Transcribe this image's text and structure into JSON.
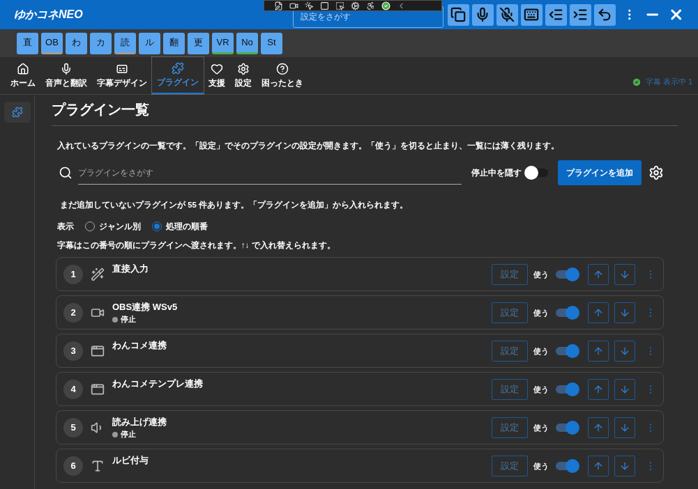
{
  "window": {
    "title": "ゆかコネNEO"
  },
  "title_search": {
    "placeholder": "設定をさがす"
  },
  "quick_buttons": [
    {
      "label": "直"
    },
    {
      "label": "OB",
      "color": "#9e9e9e"
    },
    {
      "label": "わ"
    },
    {
      "label": "カ"
    },
    {
      "label": "読",
      "color": "#9e9e9e"
    },
    {
      "label": "ル"
    },
    {
      "label": "翻"
    },
    {
      "label": "更"
    },
    {
      "label": "VR",
      "color": "#4caf50"
    },
    {
      "label": "No",
      "color": "#4caf50"
    },
    {
      "label": "St"
    }
  ],
  "tabs": [
    {
      "label": "ホーム",
      "selected": false
    },
    {
      "label": "音声と翻訳",
      "selected": false
    },
    {
      "label": "字幕デザイン",
      "selected": false
    },
    {
      "label": "プラグイン",
      "selected": true
    },
    {
      "label": "支援",
      "selected": false
    },
    {
      "label": "設定",
      "selected": false
    },
    {
      "label": "困ったとき",
      "selected": false
    }
  ],
  "status": {
    "text": "字幕 表示中 1"
  },
  "page": {
    "title": "プラグイン一覧",
    "description": "入れているプラグインの一覧です。「設定」でそのプラグインの設定が開きます。「使う」を切ると止まり、一覧には薄く残ります。",
    "search": {
      "placeholder": "プラグインをさがす"
    },
    "hide_stopped": {
      "label": "停止中を隠す",
      "on": false
    },
    "add_button": "プラグインを追加",
    "notice": "まだ追加していないプラグインが 55 件あります。「プラグインを追加」から入れられます。",
    "view": {
      "label": "表示",
      "options": [
        {
          "label": "ジャンル別",
          "selected": false
        },
        {
          "label": "処理の順番",
          "selected": true
        }
      ]
    },
    "hint": "字幕はこの番号の順にプラグインへ渡されます。↑↓ で入れ替えられます。",
    "plugins": [
      {
        "number": "1",
        "name": "直接入力",
        "settings": "設定",
        "use_label": "使う",
        "on": true
      },
      {
        "number": "2",
        "name": "OBS連携 WSv5",
        "status": "停止",
        "settings": "設定",
        "use_label": "使う",
        "on": true
      },
      {
        "number": "3",
        "name": "わんコメ連携",
        "settings": "設定",
        "use_label": "使う",
        "on": true
      },
      {
        "number": "4",
        "name": "わんコメテンプレ連携",
        "settings": "設定",
        "use_label": "使う",
        "on": true
      },
      {
        "number": "5",
        "name": "読み上げ連携",
        "status": "停止",
        "settings": "設定",
        "use_label": "使う",
        "on": true
      },
      {
        "number": "6",
        "name": "ルビ付与",
        "settings": "設定",
        "use_label": "使う",
        "on": true
      }
    ]
  }
}
